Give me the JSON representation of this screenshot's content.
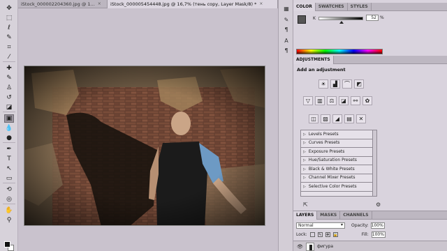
{
  "document_tabs": [
    {
      "label": "iStock_000002204360.jpg @ 1...",
      "close": "×",
      "active": false
    },
    {
      "label": "iStock_000005454448.jpg @ 16,7% (тень copy, Layer Mask/8) *",
      "close": "×",
      "active": true
    }
  ],
  "tools": [
    {
      "name": "move-tool-icon",
      "glyph": "✥"
    },
    {
      "name": "marquee-tool-icon",
      "glyph": "⬚"
    },
    {
      "name": "lasso-tool-icon",
      "glyph": "ℓ"
    },
    {
      "name": "quick-select-tool-icon",
      "glyph": "✎"
    },
    {
      "name": "crop-tool-icon",
      "glyph": "⌗"
    },
    {
      "name": "eyedropper-tool-icon",
      "glyph": "⁄"
    },
    {
      "name": "healing-brush-tool-icon",
      "glyph": "✚"
    },
    {
      "name": "brush-tool-icon",
      "glyph": "✎"
    },
    {
      "name": "clone-stamp-tool-icon",
      "glyph": "♙"
    },
    {
      "name": "history-brush-tool-icon",
      "glyph": "↺"
    },
    {
      "name": "eraser-tool-icon",
      "glyph": "◪"
    },
    {
      "name": "gradient-tool-icon",
      "glyph": "▣"
    },
    {
      "name": "blur-tool-icon",
      "glyph": "💧"
    },
    {
      "name": "dodge-tool-icon",
      "glyph": "●"
    },
    {
      "name": "pen-tool-icon",
      "glyph": "✒"
    },
    {
      "name": "type-tool-icon",
      "glyph": "T"
    },
    {
      "name": "path-select-tool-icon",
      "glyph": "↖"
    },
    {
      "name": "shape-tool-icon",
      "glyph": "▭"
    },
    {
      "name": "3d-rotate-tool-icon",
      "glyph": "⟲"
    },
    {
      "name": "3d-orbit-tool-icon",
      "glyph": "◎"
    },
    {
      "name": "hand-tool-icon",
      "glyph": "✋"
    },
    {
      "name": "zoom-tool-icon",
      "glyph": "⚲"
    }
  ],
  "mini_icons": [
    {
      "name": "color-panel-icon",
      "glyph": "▦"
    },
    {
      "name": "adjust-panel-icon",
      "glyph": "✎"
    },
    {
      "name": "paragraph-icon",
      "glyph": "¶"
    },
    {
      "name": "character-icon",
      "glyph": "A"
    },
    {
      "name": "paragraph-panel-icon",
      "glyph": "¶"
    }
  ],
  "color_panel": {
    "tabs": [
      "COLOR",
      "SWATCHES",
      "STYLES"
    ],
    "channel_label": "K",
    "value": "52",
    "unit": "%",
    "slider_level": 0.52
  },
  "adjustments_panel": {
    "tab": "ADJUSTMENTS",
    "title": "Add an adjustment",
    "row1": [
      {
        "name": "brightness-contrast-icon",
        "glyph": "☀"
      },
      {
        "name": "levels-icon",
        "glyph": "▟"
      },
      {
        "name": "curves-icon",
        "glyph": "⌒"
      },
      {
        "name": "exposure-icon",
        "glyph": "◩"
      }
    ],
    "row2": [
      {
        "name": "vibrance-icon",
        "glyph": "▽"
      },
      {
        "name": "hue-saturation-icon",
        "glyph": "▥"
      },
      {
        "name": "color-balance-icon",
        "glyph": "⚖"
      },
      {
        "name": "black-white-icon",
        "glyph": "◪"
      },
      {
        "name": "photo-filter-icon",
        "glyph": "⚯"
      },
      {
        "name": "channel-mixer-icon",
        "glyph": "✿"
      }
    ],
    "row3": [
      {
        "name": "invert-icon",
        "glyph": "◫"
      },
      {
        "name": "posterize-icon",
        "glyph": "▨"
      },
      {
        "name": "threshold-icon",
        "glyph": "◢"
      },
      {
        "name": "gradient-map-icon",
        "glyph": "▤"
      },
      {
        "name": "selective-color-icon",
        "glyph": "✕"
      }
    ],
    "presets": [
      "Levels Presets",
      "Curves Presets",
      "Exposure Presets",
      "Hue/Saturation Presets",
      "Black & White Presets",
      "Channel Mixer Presets",
      "Selective Color Presets"
    ]
  },
  "layers_panel": {
    "tabs": [
      "LAYERS",
      "MASKS",
      "CHANNELS"
    ],
    "blend_mode": "Normal",
    "opacity_label": "Opacity:",
    "opacity_value": "100%",
    "lock_label": "Lock:",
    "fill_label": "Fill:",
    "fill_value": "100%",
    "layer_name": "фигура"
  }
}
